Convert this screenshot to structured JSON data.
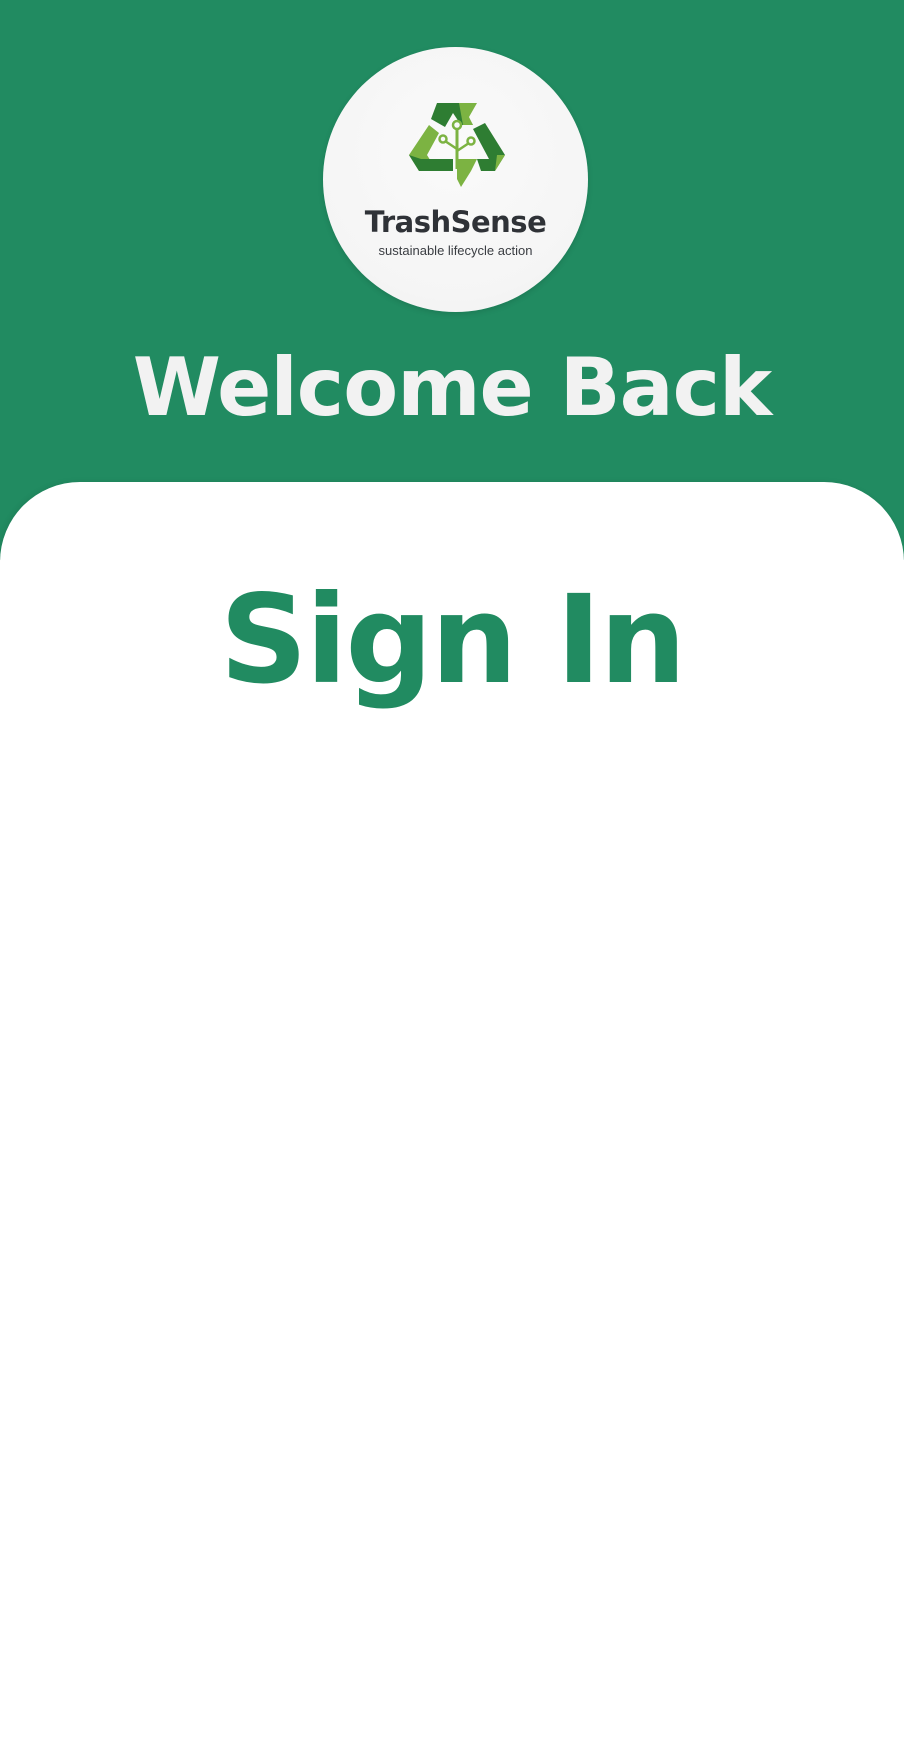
{
  "brand": {
    "name": "TrashSense",
    "tagline": "sustainable lifecycle action",
    "logo_icon": "recycle-circuit-icon"
  },
  "header": {
    "title": "Welcome Back"
  },
  "form": {
    "title": "Sign In"
  },
  "colors": {
    "primary_green": "#218b61",
    "logo_dark_green": "#2e7d32",
    "logo_light_green": "#7cb342",
    "header_text": "#f2f2f2",
    "brand_text": "#2f3237",
    "card_background": "#ffffff"
  }
}
